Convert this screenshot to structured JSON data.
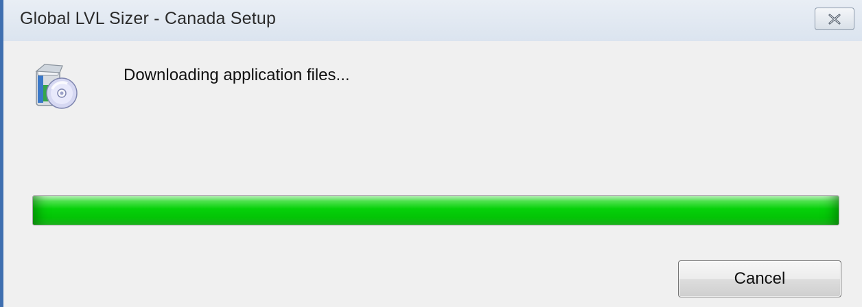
{
  "window": {
    "title": "Global LVL Sizer - Canada Setup"
  },
  "titlebar": {
    "close_icon": "close-x-icon"
  },
  "main": {
    "icon": "setup-installer-icon",
    "status_text": "Downloading application files...",
    "progress_fraction": 1.0,
    "progress_color": "#06d10a"
  },
  "buttons": {
    "cancel_label": "Cancel"
  },
  "colors": {
    "window_border": "#3f6fb0",
    "background": "#f0f0f0"
  }
}
